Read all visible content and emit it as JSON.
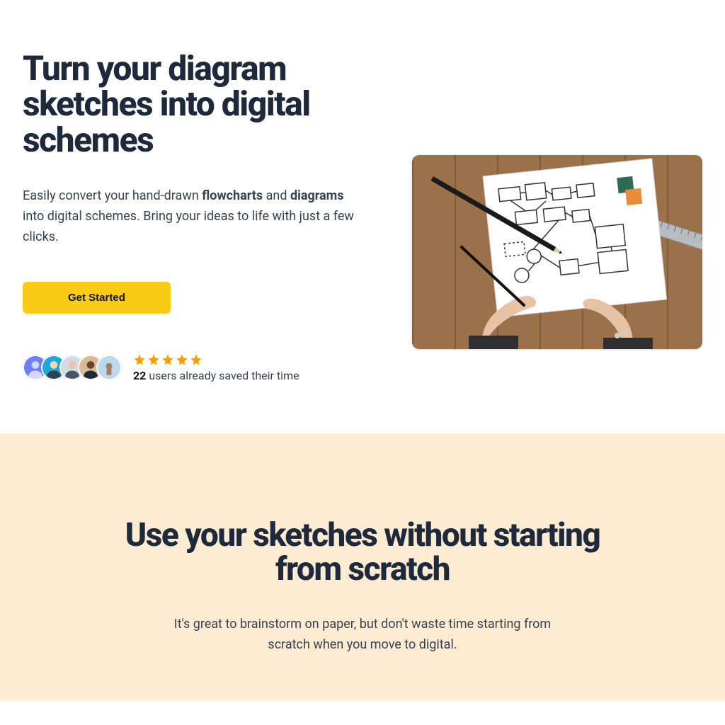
{
  "hero": {
    "title": "Turn your diagram sketches into digital schemes",
    "sub_pre": "Easily convert your hand-drawn ",
    "sub_bold1": "flowcharts",
    "sub_mid": " and ",
    "sub_bold2": "diagrams",
    "sub_post": " into digital schemes. Bring your ideas to life with just a few clicks.",
    "cta_label": "Get Started",
    "rating": {
      "stars": 5,
      "count": "22",
      "suffix": " users already saved their time"
    }
  },
  "section2": {
    "title": "Use your sketches without starting from scratch",
    "sub": "It's great to brainstorm on paper, but don't waste time starting from scratch when you move to digital."
  }
}
